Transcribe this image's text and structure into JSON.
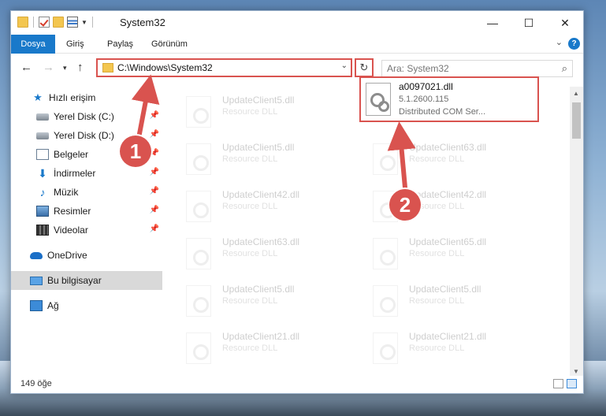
{
  "window": {
    "title": "System32"
  },
  "ribbon": {
    "tabs": [
      "Dosya",
      "Giriş",
      "Paylaş",
      "Görünüm"
    ]
  },
  "address": {
    "path": "C:\\Windows\\System32"
  },
  "search": {
    "placeholder": "Ara: System32"
  },
  "sidebar": {
    "items": [
      {
        "label": "Hızlı erişim",
        "icon": "star-icon"
      },
      {
        "label": "Yerel Disk (C:)",
        "icon": "drive-icon"
      },
      {
        "label": "Yerel Disk (D:)",
        "icon": "drive-icon"
      },
      {
        "label": "Belgeler",
        "icon": "documents-icon"
      },
      {
        "label": "İndirmeler",
        "icon": "download-icon"
      },
      {
        "label": "Müzik",
        "icon": "music-icon"
      },
      {
        "label": "Resimler",
        "icon": "pictures-icon"
      },
      {
        "label": "Videolar",
        "icon": "video-icon"
      },
      {
        "label": "OneDrive",
        "icon": "cloud-icon"
      },
      {
        "label": "Bu bilgisayar",
        "icon": "computer-icon"
      },
      {
        "label": "Ağ",
        "icon": "network-icon"
      }
    ]
  },
  "files": [
    {
      "name": "UpdateClient5.dll",
      "type": "Resource DLL"
    },
    {
      "name": "UpdateClient5.dll",
      "type": "Resource DLL"
    },
    {
      "name": "UpdateClient63.dll",
      "type": "Resource DLL"
    },
    {
      "name": "UpdateClient42.dll",
      "type": "Resource DLL"
    },
    {
      "name": "UpdateClient42.dll",
      "type": "Resource DLL"
    },
    {
      "name": "UpdateClient63.dll",
      "type": "Resource DLL"
    },
    {
      "name": "UpdateClient65.dll",
      "type": "Resource DLL"
    },
    {
      "name": "UpdateClient5.dll",
      "type": "Resource DLL"
    },
    {
      "name": "UpdateClient5.dll",
      "type": "Resource DLL"
    },
    {
      "name": "UpdateClient21.dll",
      "type": "Resource DLL"
    },
    {
      "name": "UpdateClient21.dll",
      "type": "Resource DLL"
    }
  ],
  "target_file": {
    "name": "a0097021.dll",
    "version": "5.1.2600.115",
    "description": "Distributed COM Ser..."
  },
  "markers": [
    "1",
    "2"
  ],
  "status": {
    "count": "149 öğe"
  },
  "colors": {
    "accent": "#1979ca",
    "highlight": "#d9534f"
  }
}
